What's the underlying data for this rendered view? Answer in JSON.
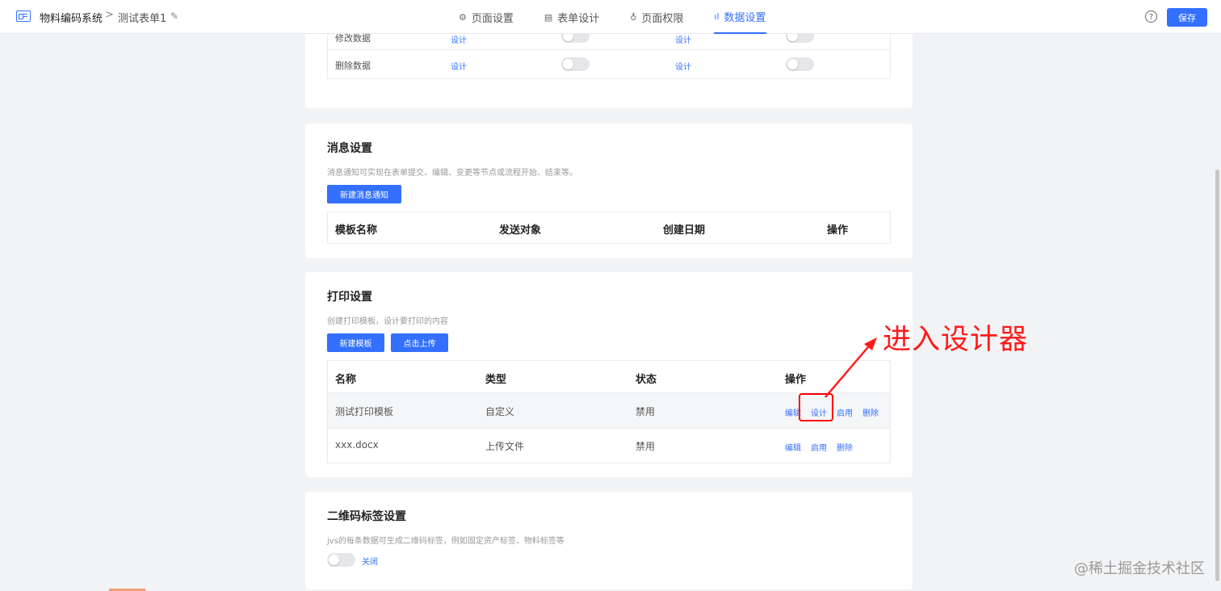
{
  "header": {
    "app_name": "物料编码系统",
    "separator": ">",
    "form_name": "测试表单1",
    "save_label": "保存",
    "help_glyph": "?",
    "tabs": [
      {
        "label": "页面设置",
        "icon": "gear-icon",
        "glyph": "⚙"
      },
      {
        "label": "表单设计",
        "icon": "form-icon",
        "glyph": "▤"
      },
      {
        "label": "页面权限",
        "icon": "lock-icon",
        "glyph": "♁"
      },
      {
        "label": "数据设置",
        "icon": "chart-icon",
        "glyph": "ıl",
        "active": true
      }
    ]
  },
  "data_ops": {
    "rows": [
      {
        "label": "修改数据",
        "link1": "设计",
        "link2": "设计"
      },
      {
        "label": "删除数据",
        "link1": "设计",
        "link2": "设计"
      }
    ]
  },
  "message_settings": {
    "title": "消息设置",
    "description": "消息通知可实现在表单提交、编辑、变更等节点或流程开始、结束等。",
    "new_button": "新建消息通知",
    "columns": [
      "模板名称",
      "发送对象",
      "创建日期",
      "操作"
    ]
  },
  "print_settings": {
    "title": "打印设置",
    "description": "创建打印模板，设计要打印的内容",
    "new_button": "新建模板",
    "upload_button": "点击上传",
    "columns": [
      "名称",
      "类型",
      "状态",
      "操作"
    ],
    "rows": [
      {
        "name": "测试打印模板",
        "type": "自定义",
        "status": "禁用",
        "actions": [
          "编辑",
          "设计",
          "启用",
          "删除"
        ]
      },
      {
        "name": "xxx.docx",
        "type": "上传文件",
        "status": "禁用",
        "actions": [
          "编辑",
          "启用",
          "删除"
        ]
      }
    ]
  },
  "qr_settings": {
    "title": "二维码标签设置",
    "description": "jvs的每条数据可生成二维码标签，例如固定资产标签、物料标签等",
    "toggle_label": "关闭"
  },
  "annotation": {
    "text": "进入设计器",
    "color": "#ff1a1a"
  },
  "watermark": "@稀土掘金技术社区",
  "colors": {
    "accent": "#3370ff",
    "background": "#f2f3f5"
  }
}
